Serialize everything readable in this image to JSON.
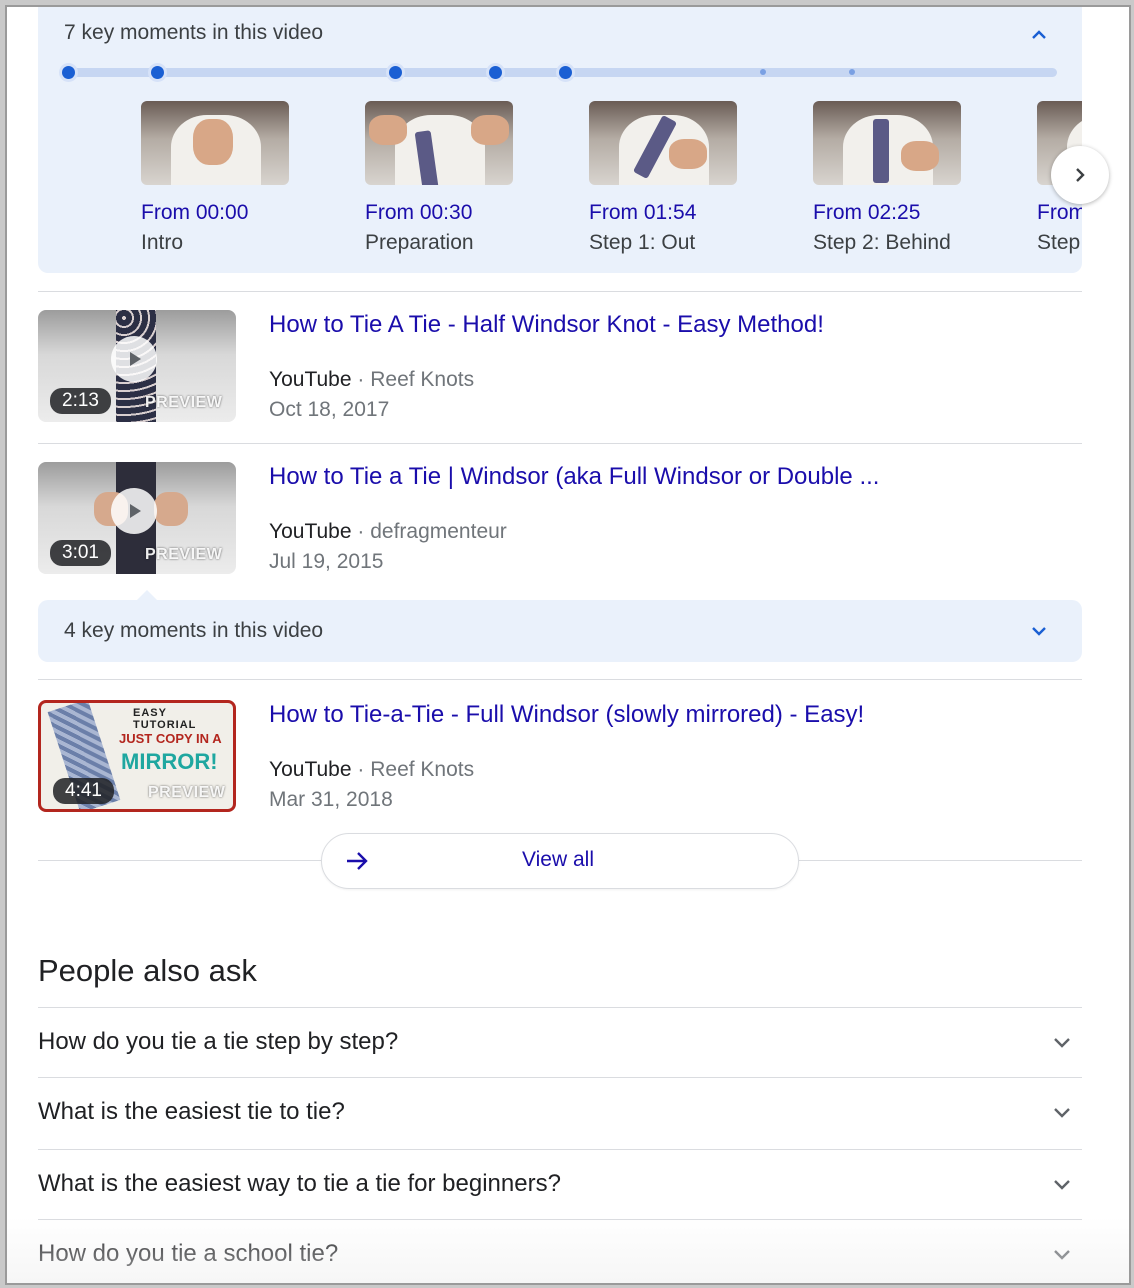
{
  "key_moments_expanded": {
    "title": "7 key moments in this video",
    "moments": [
      {
        "time": "From 00:00",
        "label": "Intro"
      },
      {
        "time": "From 00:30",
        "label": "Preparation"
      },
      {
        "time": "From 01:54",
        "label": "Step 1: Out"
      },
      {
        "time": "From 02:25",
        "label": "Step 2: Behind"
      },
      {
        "time": "From",
        "label": "Step"
      }
    ]
  },
  "results": [
    {
      "title": "How to Tie A Tie - Half Windsor Knot - Easy Method!",
      "source": "YouTube",
      "separator": "·",
      "channel": "Reef Knots",
      "date": "Oct 18, 2017",
      "duration": "2:13",
      "preview": "PREVIEW"
    },
    {
      "title": "How to Tie a Tie | Windsor (aka Full Windsor or Double ...",
      "source": "YouTube",
      "separator": "·",
      "channel": "defragmenteur",
      "date": "Jul 19, 2015",
      "duration": "3:01",
      "preview": "PREVIEW"
    },
    {
      "title": "How to Tie-a-Tie - Full Windsor (slowly mirrored) - Easy!",
      "source": "YouTube",
      "separator": "·",
      "channel": "Reef Knots",
      "date": "Mar 31, 2018",
      "duration": "4:41",
      "preview": "PREVIEW",
      "thumb_text_top": "EASY TUTORIAL",
      "thumb_text_mid": "JUST COPY IN A",
      "thumb_text_big": "MIRROR!"
    }
  ],
  "key_moments_collapsed": {
    "title": "4 key moments in this video"
  },
  "view_all": {
    "label": "View all"
  },
  "people_also_ask": {
    "title": "People also ask",
    "questions": [
      "How do you tie a tie step by step?",
      "What is the easiest tie to tie?",
      "What is the easiest way to tie a tie for beginners?",
      "How do you tie a school tie?"
    ]
  },
  "icons": {
    "expand": "chevron-up-icon",
    "collapse": "chevron-down-icon",
    "next": "chevron-right-icon",
    "play": "play-icon",
    "arrow": "arrow-right-icon"
  },
  "colors": {
    "link": "#1a0dab",
    "panel": "#eaf1fb",
    "accent": "#1a5fd3",
    "text": "#202124",
    "muted": "#70757a"
  }
}
